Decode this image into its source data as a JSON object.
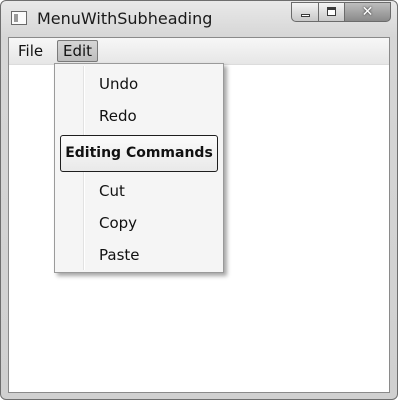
{
  "window": {
    "title": "MenuWithSubheading",
    "close_glyph": "✕"
  },
  "menubar": {
    "items": [
      {
        "label": "File"
      },
      {
        "label": "Edit"
      }
    ]
  },
  "edit_menu": {
    "items_top": [
      {
        "label": "Undo"
      },
      {
        "label": "Redo"
      }
    ],
    "subheading": "Editing Commands",
    "items_bottom": [
      {
        "label": "Cut"
      },
      {
        "label": "Copy"
      },
      {
        "label": "Paste"
      }
    ]
  }
}
